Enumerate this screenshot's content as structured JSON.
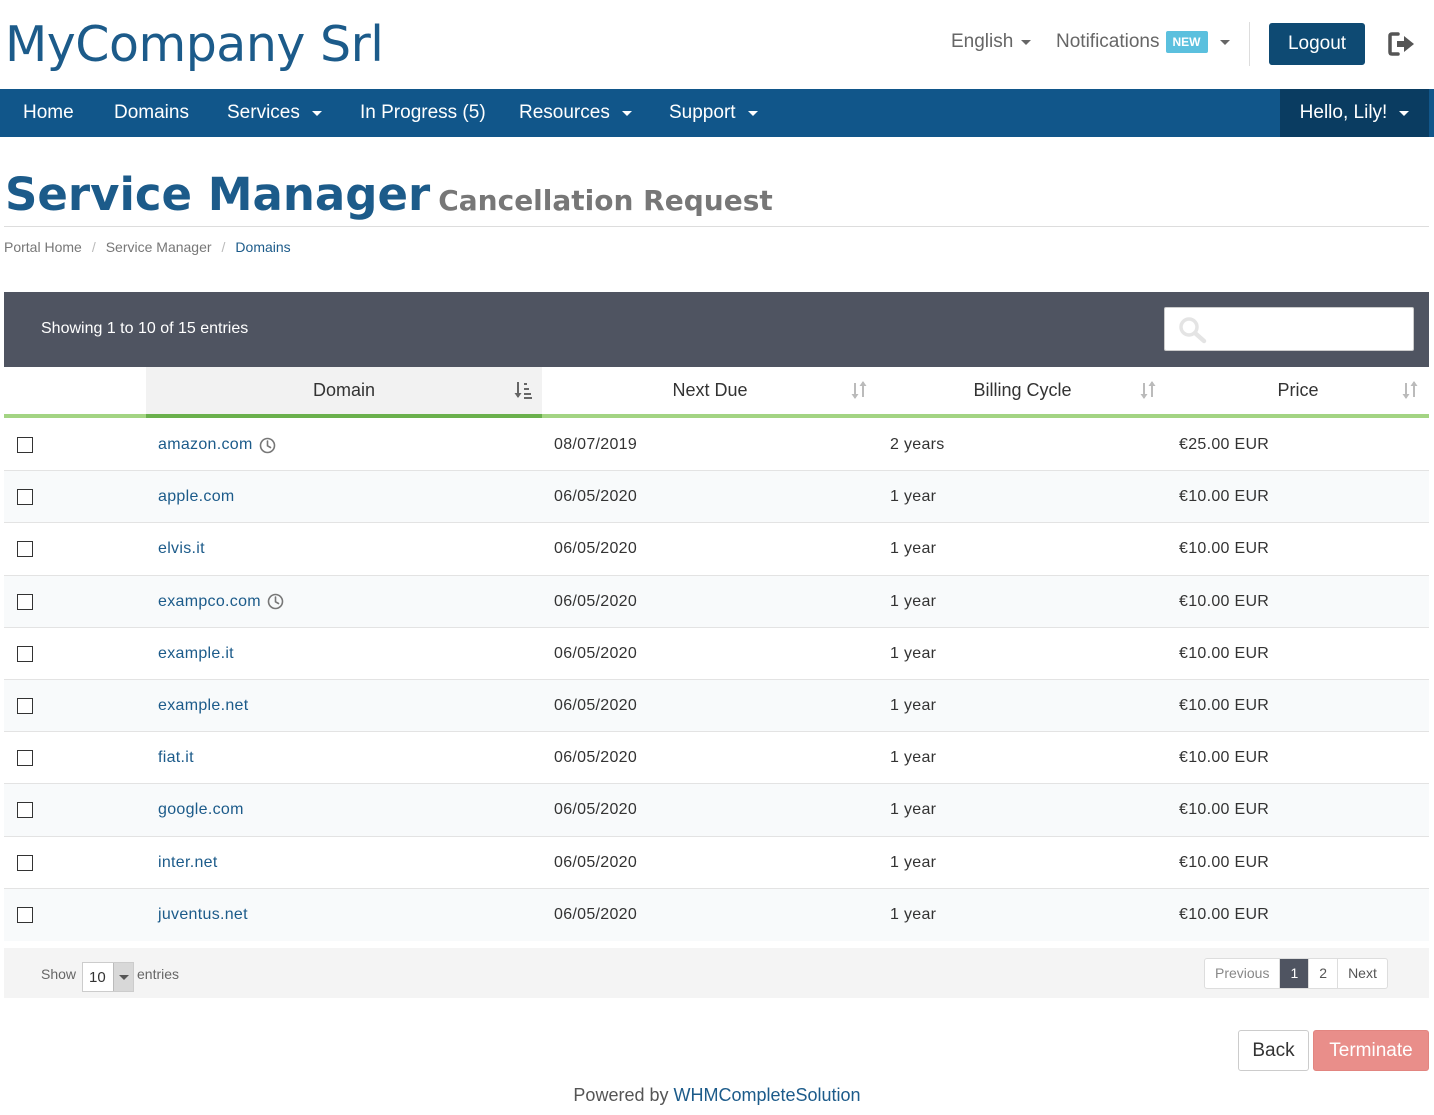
{
  "header": {
    "logo": "MyCompany Srl",
    "language": "English",
    "notifications": "Notifications",
    "notifications_badge": "NEW",
    "logout": "Logout"
  },
  "nav": {
    "items": [
      "Home",
      "Domains",
      "Services",
      "In Progress (5)",
      "Resources",
      "Support"
    ],
    "user": "Hello, Lily!"
  },
  "page": {
    "title": "Service Manager",
    "subtitle": "Cancellation Request"
  },
  "breadcrumb": [
    "Portal Home",
    "Service Manager",
    "Domains"
  ],
  "table": {
    "showing": "Showing 1 to 10 of 15 entries",
    "search_placeholder": "",
    "columns": [
      "Domain",
      "Next Due",
      "Billing Cycle",
      "Price"
    ],
    "rows": [
      {
        "domain": "amazon.com",
        "clock": true,
        "due": "08/07/2019",
        "cycle": "2 years",
        "price": "€25.00 EUR"
      },
      {
        "domain": "apple.com",
        "clock": false,
        "due": "06/05/2020",
        "cycle": "1 year",
        "price": "€10.00 EUR"
      },
      {
        "domain": "elvis.it",
        "clock": false,
        "due": "06/05/2020",
        "cycle": "1 year",
        "price": "€10.00 EUR"
      },
      {
        "domain": "exampco.com",
        "clock": true,
        "due": "06/05/2020",
        "cycle": "1 year",
        "price": "€10.00 EUR"
      },
      {
        "domain": "example.it",
        "clock": false,
        "due": "06/05/2020",
        "cycle": "1 year",
        "price": "€10.00 EUR"
      },
      {
        "domain": "example.net",
        "clock": false,
        "due": "06/05/2020",
        "cycle": "1 year",
        "price": "€10.00 EUR"
      },
      {
        "domain": "fiat.it",
        "clock": false,
        "due": "06/05/2020",
        "cycle": "1 year",
        "price": "€10.00 EUR"
      },
      {
        "domain": "google.com",
        "clock": false,
        "due": "06/05/2020",
        "cycle": "1 year",
        "price": "€10.00 EUR"
      },
      {
        "domain": "inter.net",
        "clock": false,
        "due": "06/05/2020",
        "cycle": "1 year",
        "price": "€10.00 EUR"
      },
      {
        "domain": "juventus.net",
        "clock": false,
        "due": "06/05/2020",
        "cycle": "1 year",
        "price": "€10.00 EUR"
      }
    ],
    "show_label": "Show",
    "page_length": "10",
    "entries_label": "entries",
    "pagination": {
      "previous": "Previous",
      "pages": [
        "1",
        "2"
      ],
      "next": "Next"
    }
  },
  "actions": {
    "back": "Back",
    "terminate": "Terminate"
  },
  "footer": {
    "powered_by": "Powered by",
    "link": "WHMCompleteSolution"
  }
}
